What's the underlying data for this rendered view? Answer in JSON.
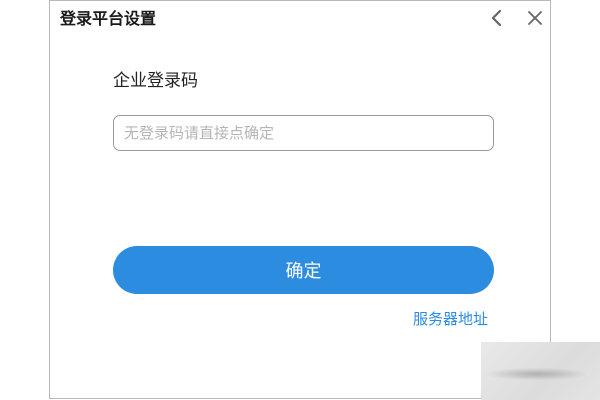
{
  "dialog": {
    "title": "登录平台设置",
    "back_icon": "chevron-left-icon",
    "close_icon": "close-icon"
  },
  "form": {
    "label": "企业登录码",
    "input_value": "",
    "input_placeholder": "无登录码请直接点确定",
    "confirm_label": "确定",
    "server_link_label": "服务器地址"
  },
  "colors": {
    "accent": "#2b8ce0",
    "border": "#9a9a9a",
    "placeholder": "#b5b5b5"
  }
}
